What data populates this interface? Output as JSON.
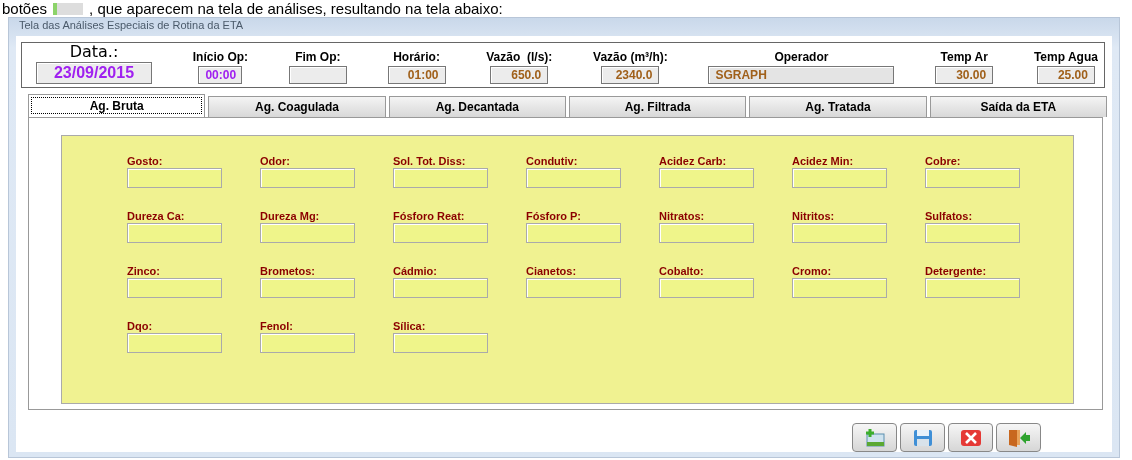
{
  "document_text": {
    "before": "botões",
    "after": ", que aparecem na tela de análises, resultando na tela abaixo:"
  },
  "window": {
    "title": "Tela das Análises Especiais de Rotina da ETA"
  },
  "header_fields": [
    {
      "label": "Data.:",
      "value": "23/09/2015",
      "kind": "large"
    },
    {
      "label": "Início Op:",
      "value": "00:00",
      "kind": "accent"
    },
    {
      "label": "Fim Op:",
      "kind": "plain"
    },
    {
      "label": "Horário:",
      "value": "01:00",
      "kind": "plain"
    },
    {
      "label": "Vazão  (l/s):",
      "value": "650.0",
      "kind": "plain"
    },
    {
      "label": "Vazão (m³/h):",
      "value": "2340.0",
      "kind": "plain"
    },
    {
      "label": "Operador",
      "value": "SGRAPH",
      "kind": "wide"
    },
    {
      "label": "Temp Ar",
      "value": "30.00",
      "kind": "plain"
    },
    {
      "label": "Temp Agua",
      "value": "25.00",
      "kind": "plain"
    }
  ],
  "tabs": [
    {
      "label": "Ag. Bruta",
      "selected": true
    },
    {
      "label": "Ag. Coagulada",
      "selected": false
    },
    {
      "label": "Ag. Decantada",
      "selected": false
    },
    {
      "label": "Ag. Filtrada",
      "selected": false
    },
    {
      "label": "Ag. Tratada",
      "selected": false
    },
    {
      "label": "Saída da ETA",
      "selected": false
    }
  ],
  "fields": [
    {
      "label": "Gosto:"
    },
    {
      "label": "Odor:"
    },
    {
      "label": "Sol. Tot. Diss:"
    },
    {
      "label": "Condutiv:"
    },
    {
      "label": "Acidez Carb:"
    },
    {
      "label": "Acidez Min:"
    },
    {
      "label": "Cobre:"
    },
    {
      "label": "Dureza Ca:"
    },
    {
      "label": "Dureza Mg:"
    },
    {
      "label": "Fósforo Reat:"
    },
    {
      "label": "Fósforo P:"
    },
    {
      "label": "Nitratos:"
    },
    {
      "label": "Nitritos:"
    },
    {
      "label": "Sulfatos:"
    },
    {
      "label": "Zinco:"
    },
    {
      "label": "Brometos:"
    },
    {
      "label": "Cádmio:"
    },
    {
      "label": "Cianetos:"
    },
    {
      "label": "Cobalto:"
    },
    {
      "label": "Cromo:"
    },
    {
      "label": "Detergente:"
    },
    {
      "label": "Dqo:"
    },
    {
      "label": "Fenol:"
    },
    {
      "label": "Sílica:"
    }
  ],
  "toolbar": [
    {
      "kind": "new"
    },
    {
      "kind": "save"
    },
    {
      "kind": "cancel"
    },
    {
      "kind": "exit"
    }
  ]
}
